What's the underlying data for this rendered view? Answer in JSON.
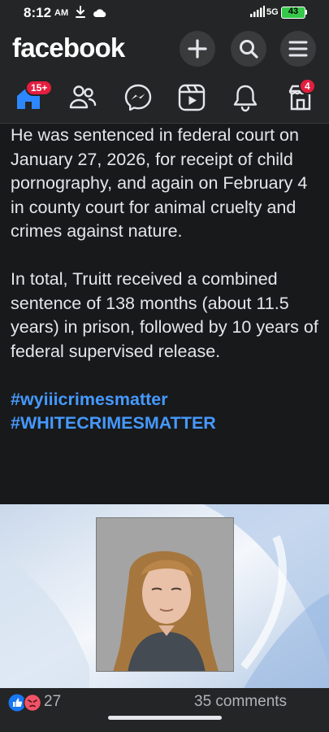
{
  "status_bar": {
    "time": "8:12",
    "ampm": "AM",
    "network": "5G",
    "battery": "43"
  },
  "header": {
    "logo": "facebook",
    "buttons": [
      {
        "icon": "plus-icon"
      },
      {
        "icon": "search-icon"
      },
      {
        "icon": "menu-icon"
      }
    ]
  },
  "nav_tabs": [
    {
      "icon": "home-icon",
      "badge": "15+"
    },
    {
      "icon": "friends-icon",
      "badge": ""
    },
    {
      "icon": "messenger-icon",
      "badge": ""
    },
    {
      "icon": "reels-icon",
      "badge": ""
    },
    {
      "icon": "bell-icon",
      "badge": ""
    },
    {
      "icon": "marketplace-icon",
      "badge": "4"
    }
  ],
  "post": {
    "paragraph_1": "He was sentenced in federal court on January 27, 2026, for receipt of child pornography, and again on February 4 in county court for animal cruelty and crimes against nature.",
    "paragraph_2": "In total, Truitt received a combined sentence of 138 months (about 11.5 years) in prison, followed by 10 years of federal supervised release.",
    "hashtag_1": "#wyiiicrimesmatter",
    "hashtag_2": "#WHITECRIMESMATTER"
  },
  "engagement": {
    "reaction_count": "27",
    "comments": "35 comments"
  },
  "colors": {
    "background": "#18191a",
    "bar": "#242526",
    "link": "#4599ff",
    "badge": "#e41e3f",
    "like": "#1877f2",
    "angry": "#f25268"
  }
}
